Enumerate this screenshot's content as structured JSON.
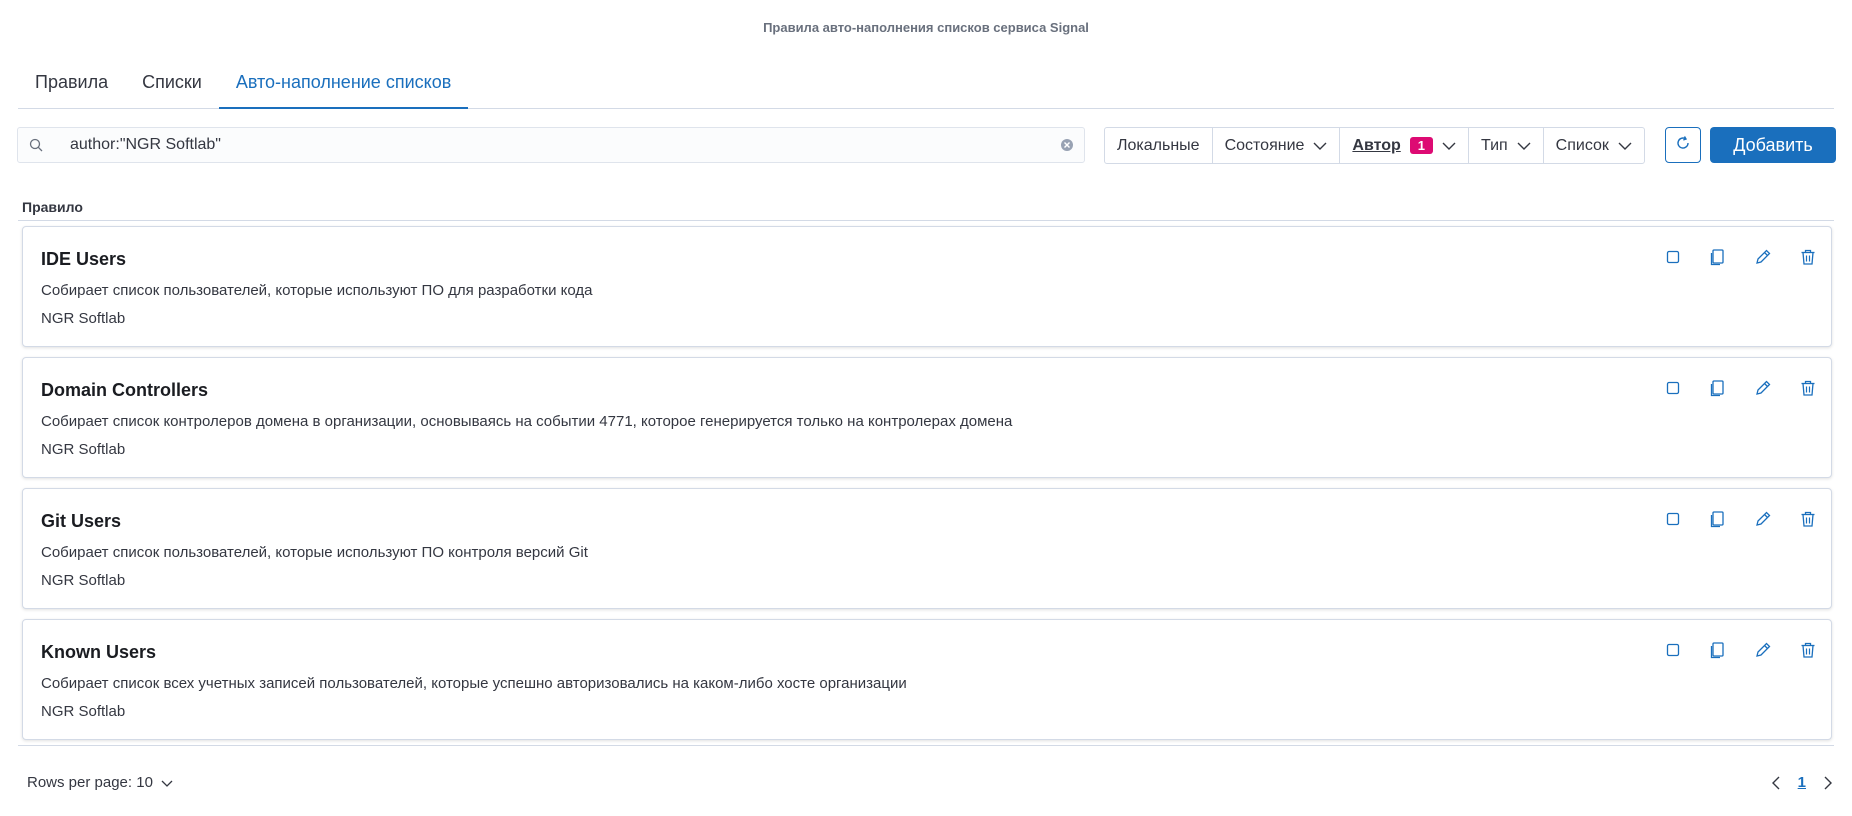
{
  "page_title": "Правила авто-наполнения списков сервиса Signal",
  "tabs": [
    {
      "label": "Правила",
      "active": false
    },
    {
      "label": "Списки",
      "active": false
    },
    {
      "label": "Авто-наполнение списков",
      "active": true
    }
  ],
  "search": {
    "value": "author:\"NGR Softlab\"",
    "icon": "search-icon",
    "clear_icon": "clear-icon"
  },
  "filters": {
    "local": "Локальные",
    "state": "Состояние",
    "author": "Автор",
    "author_count": "1",
    "type": "Тип",
    "list": "Список"
  },
  "add_button": "Добавить",
  "table": {
    "column_header": "Правило"
  },
  "rules": [
    {
      "title": "IDE Users",
      "description": "Собирает список пользователей, которые используют ПО для разработки кода",
      "author": "NGR Softlab"
    },
    {
      "title": "Domain Controllers",
      "description": "Собирает список контролеров домена в организации, основываясь на событии 4771, которое генерируется только на контролерах домена",
      "author": "NGR Softlab"
    },
    {
      "title": "Git Users",
      "description": "Собирает список пользователей, которые используют ПО контроля версий Git",
      "author": "NGR Softlab"
    },
    {
      "title": "Known Users",
      "description": "Собирает список всех учетных записей пользователей, которые успешно авторизовались на каком-либо хосте организации",
      "author": "NGR Softlab"
    }
  ],
  "pagination": {
    "rows_per_page": "Rows per page: 10",
    "current_page": "1"
  },
  "colors": {
    "accent": "#1a6fbd",
    "badge": "#dd0a73",
    "border": "#d3dae6"
  }
}
